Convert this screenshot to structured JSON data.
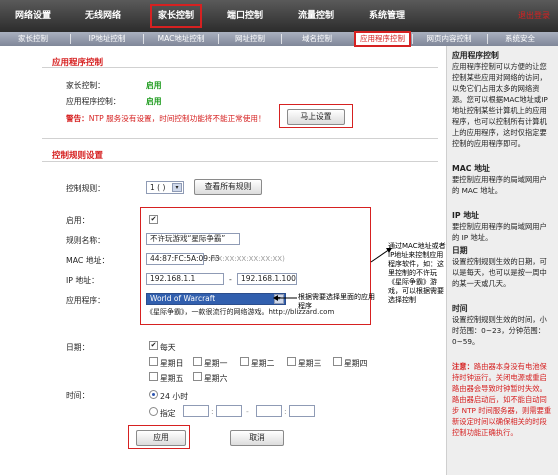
{
  "top_nav": [
    "网络设置",
    "无线网络",
    "家长控制",
    "端口控制",
    "流量控制",
    "系统管理"
  ],
  "top_logout": "退出登录",
  "sub_nav": [
    "家长控制",
    "IP地址控制",
    "MAC地址控制",
    "网址控制",
    "域名控制",
    "应用程序控制",
    "网页内容控制",
    "系统安全"
  ],
  "app_control": {
    "title": "应用程序控制",
    "parental_label": "家长控制：",
    "parental_value": "启用",
    "app_label": "应用程序控制：",
    "app_value": "启用",
    "warning_prefix": "警告：",
    "warning_text": "NTP 服务没有设置，时间控制功能将不能正常使用！",
    "set_button": "马上设置"
  },
  "rules": {
    "title": "控制规则设置",
    "rule_label": "控制规则：",
    "rule_value": "1 ( )",
    "view_all_button": "查看所有规则",
    "enable_label": "启用：",
    "name_label": "规则名称：",
    "name_value": "不许玩游戏“星际争霸”",
    "mac_label": "MAC 地址：",
    "mac_value": "44:87:FC:5A:09:F3",
    "mac_hint": "(XX:XX:XX:XX:XX:XX)",
    "ip_label": "IP 地址：",
    "ip_start": "192.168.1.1",
    "ip_sep": "-",
    "ip_end": "192.168.1.100",
    "app_label": "应用程序：",
    "app_value": "World of Warcraft",
    "app_desc": "《星际争霸》，一款很流行的网络游戏。http://blizzard.com",
    "date_label": "日期：",
    "everyday": "每天",
    "days": [
      "星期日",
      "星期一",
      "星期二",
      "星期三",
      "星期四",
      "星期五",
      "星期六"
    ],
    "time_label": "时间：",
    "time_24h": "24 小时",
    "time_custom": "指定",
    "apply_button": "应用",
    "cancel_button": "取消"
  },
  "annotations": {
    "mac_ip_note": "通过MAC地址或者IP地址来控制应用程序软件，如：这里控制的不许玩《星际争霸》游戏，可以根据需要选择控制",
    "app_note": "根据需要选择里面的应用程序"
  },
  "help": {
    "sections": [
      {
        "title": "应用程序控制",
        "text": "应用程序控制可以方便的让您控制某些应用对网络的访问，以免它们占用太多的网络资源。您可以根据MAC地址或IP地址控制某些计算机上的应用程序，也可以控制所有计算机上的应用程序，这时仅指定要控制的应用程序即可。"
      },
      {
        "title": "MAC 地址",
        "text": "要控制应用程序的局域网用户的 MAC 地址。"
      },
      {
        "title": "IP 地址",
        "text": "要控制应用程序的局域网用户的 IP 地址。"
      },
      {
        "title": "日期",
        "text": "设置控制规则生效的日期，可以是每天，也可以是按一周中的某一天或几天。"
      },
      {
        "title": "时间",
        "text": "设置控制规则生效的时间，小时范围：0~23，分钟范围：0~59。"
      }
    ],
    "note_prefix": "注意：",
    "note_text": "路由器本身没有电池保持时钟运行。关闭电源或重启路由器会导致时钟暂时失效。路由器启动后，如不能自动同步 NTP 时间服务器，则需要重新设定时间以确保相关的时段控制功能正确执行。"
  },
  "colors": {
    "accent_red": "#d62121",
    "enabled_green": "#1d9b1d",
    "nav_dark": "#3a3a3a",
    "subnav_blue": "#8a92a6"
  }
}
